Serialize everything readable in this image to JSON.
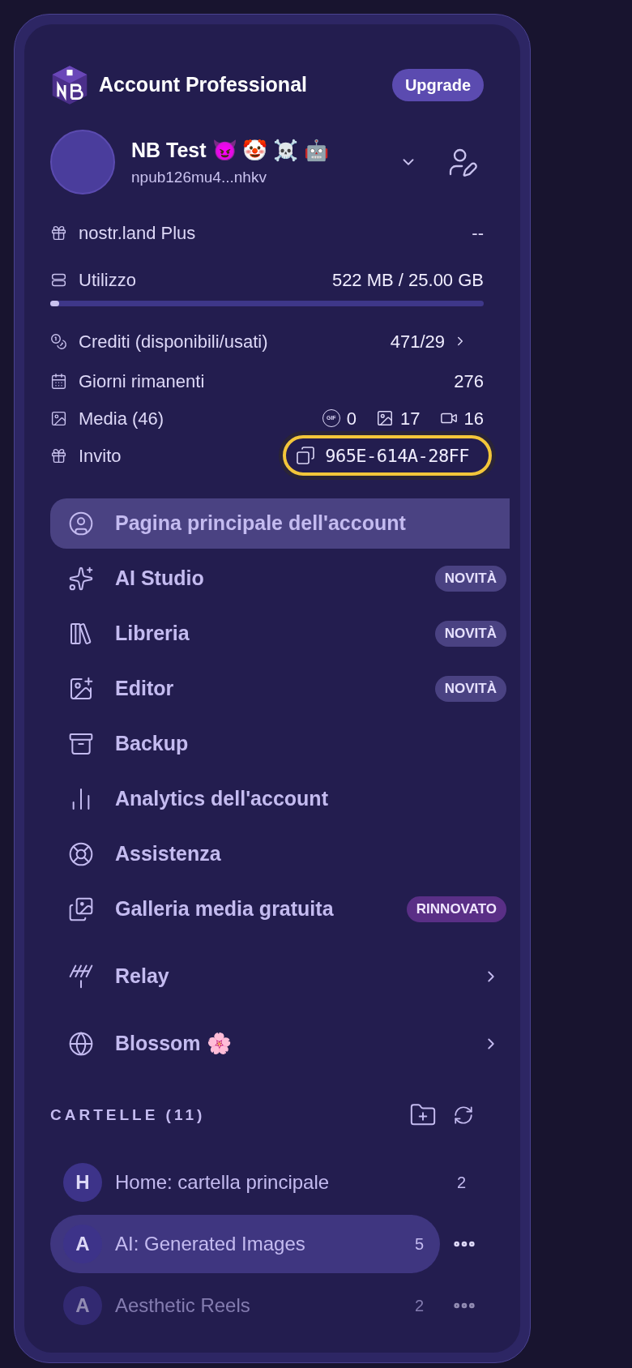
{
  "header": {
    "title": "Account Professional",
    "upgrade_button": "Upgrade"
  },
  "profile": {
    "name": "NB Test 😈 🤡 ☠️ 🤖",
    "npub": "npub126mu4...nhkv"
  },
  "stats": {
    "plus": {
      "label": "nostr.land Plus",
      "value": "--"
    },
    "usage": {
      "label": "Utilizzo",
      "value": "522 MB / 25.00 GB",
      "level": 0.02
    },
    "credits": {
      "label": "Crediti (disponibili/usati)",
      "value": "471/29"
    },
    "days": {
      "label": "Giorni rimanenti",
      "value": "276"
    },
    "media": {
      "label": "Media (46)",
      "counts": [
        {
          "kind": "gif",
          "icon_text": "GIF",
          "value": "0"
        },
        {
          "kind": "image",
          "value": "17"
        },
        {
          "kind": "video",
          "value": "16"
        }
      ]
    },
    "invite": {
      "label": "Invito",
      "code": "965E-614A-28FF",
      "highlighted": true
    }
  },
  "menu": [
    {
      "label": "Pagina principale dell'account",
      "selected": true
    },
    {
      "label": "AI Studio",
      "selected": false,
      "badge": {
        "text": "NOVITÀ",
        "kind": "new"
      }
    },
    {
      "label": "Libreria",
      "selected": false,
      "badge": {
        "text": "NOVITÀ",
        "kind": "new"
      }
    },
    {
      "label": "Editor",
      "selected": false,
      "badge": {
        "text": "NOVITÀ",
        "kind": "new"
      }
    },
    {
      "label": "Backup",
      "selected": false
    },
    {
      "label": "Analytics dell'account",
      "selected": false
    },
    {
      "label": "Assistenza",
      "selected": false
    },
    {
      "label": "Galleria media gratuita",
      "selected": false,
      "badge": {
        "text": "RINNOVATO",
        "kind": "renewed"
      }
    },
    {
      "label": "Relay",
      "selected": false,
      "submenu": true
    },
    {
      "label": "Blossom 🌸",
      "selected": false,
      "submenu": true
    }
  ],
  "folders": {
    "title": "CARTELLE (11)",
    "items": [
      {
        "letter": "H",
        "name": "Home: cartella principale",
        "count": "2",
        "selected": false,
        "faded": false
      },
      {
        "letter": "A",
        "name": "AI: Generated Images",
        "count": "5",
        "selected": true,
        "faded": false
      },
      {
        "letter": "A",
        "name": "Aesthetic Reels",
        "count": "2",
        "selected": false,
        "faded": true
      }
    ]
  }
}
